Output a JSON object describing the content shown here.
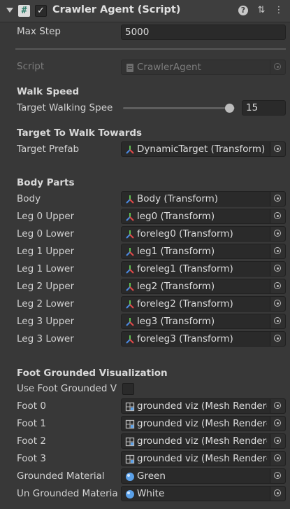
{
  "header": {
    "title": "Crawler Agent (Script)",
    "script_icon_glyph": "#",
    "enabled_glyph": "✓",
    "help_glyph": "?",
    "presets_glyph": "⇅",
    "menu_glyph": "⋮"
  },
  "max_step": {
    "label": "Max Step",
    "value": "5000"
  },
  "script": {
    "label": "Script",
    "value": "CrawlerAgent"
  },
  "walk_speed": {
    "heading": "Walk Speed",
    "label": "Target Walking Spee",
    "value": "15",
    "slider_fraction": 0.95
  },
  "target": {
    "heading": "Target To Walk Towards",
    "label": "Target Prefab",
    "value": "DynamicTarget (Transform)"
  },
  "body_parts": {
    "heading": "Body Parts",
    "items": [
      {
        "label": "Body",
        "value": "Body (Transform)"
      },
      {
        "label": "Leg 0 Upper",
        "value": "leg0 (Transform)"
      },
      {
        "label": "Leg 0 Lower",
        "value": "foreleg0 (Transform)"
      },
      {
        "label": "Leg 1 Upper",
        "value": "leg1 (Transform)"
      },
      {
        "label": "Leg 1 Lower",
        "value": "foreleg1 (Transform)"
      },
      {
        "label": "Leg 2 Upper",
        "value": "leg2 (Transform)"
      },
      {
        "label": "Leg 2 Lower",
        "value": "foreleg2 (Transform)"
      },
      {
        "label": "Leg 3 Upper",
        "value": "leg3 (Transform)"
      },
      {
        "label": "Leg 3 Lower",
        "value": "foreleg3 (Transform)"
      }
    ]
  },
  "foot_viz": {
    "heading": "Foot Grounded Visualization",
    "use_label": "Use Foot Grounded V",
    "use_checked": false,
    "feet": [
      {
        "label": "Foot 0",
        "value": "grounded viz (Mesh Renderer)"
      },
      {
        "label": "Foot 1",
        "value": "grounded viz (Mesh Renderer)"
      },
      {
        "label": "Foot 2",
        "value": "grounded viz (Mesh Renderer)"
      },
      {
        "label": "Foot 3",
        "value": "grounded viz (Mesh Renderer)"
      }
    ],
    "grounded_material": {
      "label": "Grounded Material",
      "value": "Green"
    },
    "ungrounded_material": {
      "label": "Un Grounded Materia",
      "value": "White"
    }
  },
  "colors": {
    "background": "#383838",
    "field": "#2a2a2a",
    "transform_icon": [
      "#e24a4a",
      "#5fc24f",
      "#4a8ae2"
    ],
    "material_icon": "#5aa0e8"
  }
}
